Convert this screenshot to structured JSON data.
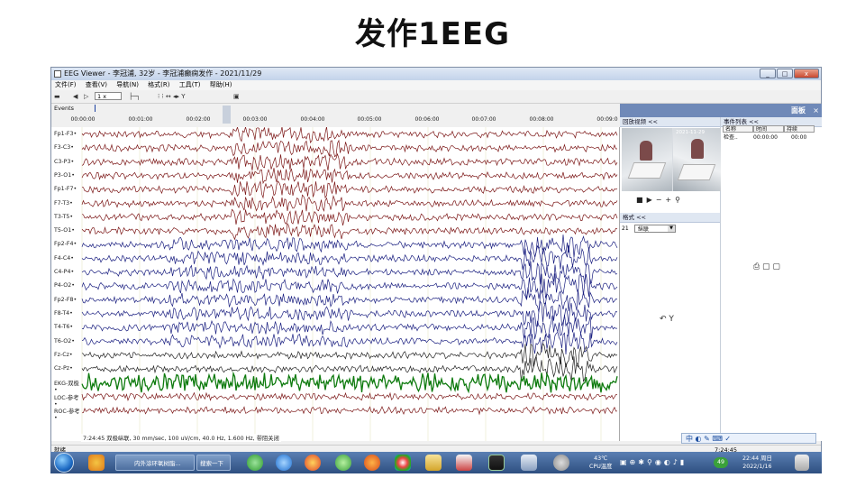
{
  "slide": {
    "title": "发作1EEG"
  },
  "window": {
    "title": "EEG Viewer - 李冠浦, 32岁 - 李冠浦癫痫发作 - 2021/11/29",
    "min": "_",
    "max": "□",
    "close": "x"
  },
  "menu": [
    "文件(F)",
    "查看(V)",
    "导航(N)",
    "格式(R)",
    "工具(T)",
    "帮助(H)"
  ],
  "toolbar": {
    "speed": "1 x"
  },
  "events_label": "Events",
  "time_ticks": [
    "00:00:00",
    "00:01:00",
    "00:02:00",
    "00:03:00",
    "00:04:00",
    "00:05:00",
    "00:06:00",
    "00:07:00",
    "00:08:00",
    "00:09:0"
  ],
  "channels": [
    {
      "label": "Fp1-F3",
      "color": "#7b1616"
    },
    {
      "label": "F3-C3",
      "color": "#7b1616"
    },
    {
      "label": "C3-P3",
      "color": "#7b1616"
    },
    {
      "label": "P3-O1",
      "color": "#7b1616"
    },
    {
      "label": "Fp1-F7",
      "color": "#7b1616"
    },
    {
      "label": "F7-T3",
      "color": "#7b1616"
    },
    {
      "label": "T3-T5",
      "color": "#7b1616"
    },
    {
      "label": "T5-O1",
      "color": "#7b1616"
    },
    {
      "label": "Fp2-F4",
      "color": "#1a1f80"
    },
    {
      "label": "F4-C4",
      "color": "#1a1f80"
    },
    {
      "label": "C4-P4",
      "color": "#1a1f80"
    },
    {
      "label": "P4-O2",
      "color": "#1a1f80"
    },
    {
      "label": "Fp2-F8",
      "color": "#1a1f80"
    },
    {
      "label": "F8-T4",
      "color": "#1a1f80"
    },
    {
      "label": "T4-T6",
      "color": "#1a1f80"
    },
    {
      "label": "T6-O2",
      "color": "#1a1f80"
    },
    {
      "label": "Fz-Cz",
      "color": "#222222"
    },
    {
      "label": "Cz-Pz",
      "color": "#222222"
    },
    {
      "label": "EKG-双极",
      "color": "#0d7a0d"
    },
    {
      "label": "LOC-参考",
      "color": "#7b1616"
    },
    {
      "label": "ROC-参考",
      "color": "#7b1616"
    }
  ],
  "eeg_info": "7:24:45 双极纵联, 30 mm/sec, 100 uV/cm, 40.0 Hz, 1.600 Hz, 带阻关闭",
  "panel": {
    "title": "面板",
    "close": "×",
    "video_section": "回放视频 <<",
    "events_section": "事件列表 <<",
    "format_section": "格式 <<",
    "event_columns": [
      "名称",
      "时间",
      "持续"
    ],
    "event_rows": [
      [
        "检查..",
        "00:00:00",
        "00:00"
      ]
    ],
    "montage_num": "21",
    "montage_value": "纵联",
    "video_stamp": "2021-11-29"
  },
  "status": {
    "left": "就绪",
    "right": "7:24:45"
  },
  "taskbar": {
    "task1": "内外涂环氧树脂...",
    "task2": "搜索一下",
    "temp": "43℃",
    "temp_label": "CPU温度",
    "time": "22:44 周日",
    "date": "2022/1/16",
    "badge": "49"
  },
  "ime": "中"
}
